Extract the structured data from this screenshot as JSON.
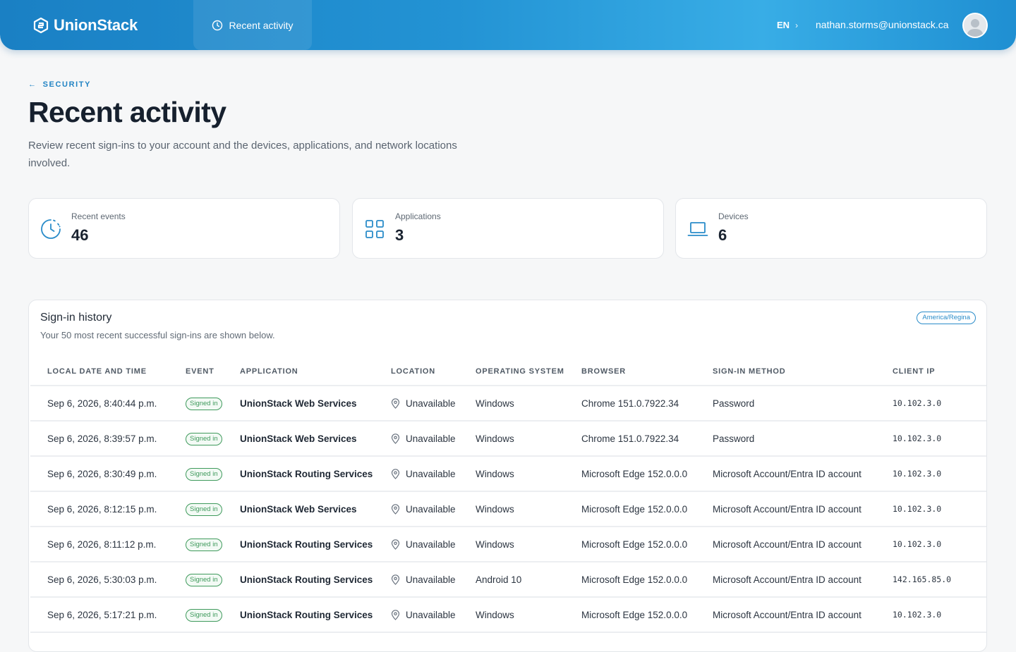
{
  "header": {
    "brand": "UnionStack",
    "nav_tab": "Recent activity",
    "lang": "EN",
    "lang_chevron": "›",
    "user_email": "nathan.storms@unionstack.ca"
  },
  "page": {
    "breadcrumb_arrow": "←",
    "breadcrumb": "SECURITY",
    "title": "Recent activity",
    "description": "Review recent sign-ins to your account and the devices, applications, and network locations involved."
  },
  "stats": [
    {
      "label": "Recent events",
      "value": "46",
      "icon": "clock-icon"
    },
    {
      "label": "Applications",
      "value": "3",
      "icon": "apps-grid-icon"
    },
    {
      "label": "Devices",
      "value": "6",
      "icon": "laptop-icon"
    }
  ],
  "history": {
    "title": "Sign-in history",
    "subtitle": "Your 50 most recent successful sign-ins are shown below.",
    "timezone": "America/Regina",
    "columns": [
      "LOCAL DATE AND TIME",
      "EVENT",
      "APPLICATION",
      "LOCATION",
      "OPERATING SYSTEM",
      "BROWSER",
      "SIGN-IN METHOD",
      "CLIENT IP"
    ],
    "rows": [
      {
        "datetime": "Sep 6, 2026, 8:40:44 p.m.",
        "event": "Signed in",
        "application": "UnionStack Web Services",
        "location": "Unavailable",
        "os": "Windows",
        "browser": "Chrome 151.0.7922.34",
        "method": "Password",
        "ip": "10.102.3.0"
      },
      {
        "datetime": "Sep 6, 2026, 8:39:57 p.m.",
        "event": "Signed in",
        "application": "UnionStack Web Services",
        "location": "Unavailable",
        "os": "Windows",
        "browser": "Chrome 151.0.7922.34",
        "method": "Password",
        "ip": "10.102.3.0"
      },
      {
        "datetime": "Sep 6, 2026, 8:30:49 p.m.",
        "event": "Signed in",
        "application": "UnionStack Routing Services",
        "location": "Unavailable",
        "os": "Windows",
        "browser": "Microsoft Edge 152.0.0.0",
        "method": "Microsoft Account/Entra ID account",
        "ip": "10.102.3.0"
      },
      {
        "datetime": "Sep 6, 2026, 8:12:15 p.m.",
        "event": "Signed in",
        "application": "UnionStack Web Services",
        "location": "Unavailable",
        "os": "Windows",
        "browser": "Microsoft Edge 152.0.0.0",
        "method": "Microsoft Account/Entra ID account",
        "ip": "10.102.3.0"
      },
      {
        "datetime": "Sep 6, 2026, 8:11:12 p.m.",
        "event": "Signed in",
        "application": "UnionStack Routing Services",
        "location": "Unavailable",
        "os": "Windows",
        "browser": "Microsoft Edge 152.0.0.0",
        "method": "Microsoft Account/Entra ID account",
        "ip": "10.102.3.0"
      },
      {
        "datetime": "Sep 6, 2026, 5:30:03 p.m.",
        "event": "Signed in",
        "application": "UnionStack Routing Services",
        "location": "Unavailable",
        "os": "Android 10",
        "browser": "Microsoft Edge 152.0.0.0",
        "method": "Microsoft Account/Entra ID account",
        "ip": "142.165.85.0"
      },
      {
        "datetime": "Sep 6, 2026, 5:17:21 p.m.",
        "event": "Signed in",
        "application": "UnionStack Routing Services",
        "location": "Unavailable",
        "os": "Windows",
        "browser": "Microsoft Edge 152.0.0.0",
        "method": "Microsoft Account/Entra ID account",
        "ip": "10.102.3.0"
      }
    ]
  },
  "colors": {
    "header_gradient_start": "#1a80c4",
    "header_gradient_end": "#38ade6",
    "accent": "#2284c4",
    "success": "#3f9a5c"
  }
}
